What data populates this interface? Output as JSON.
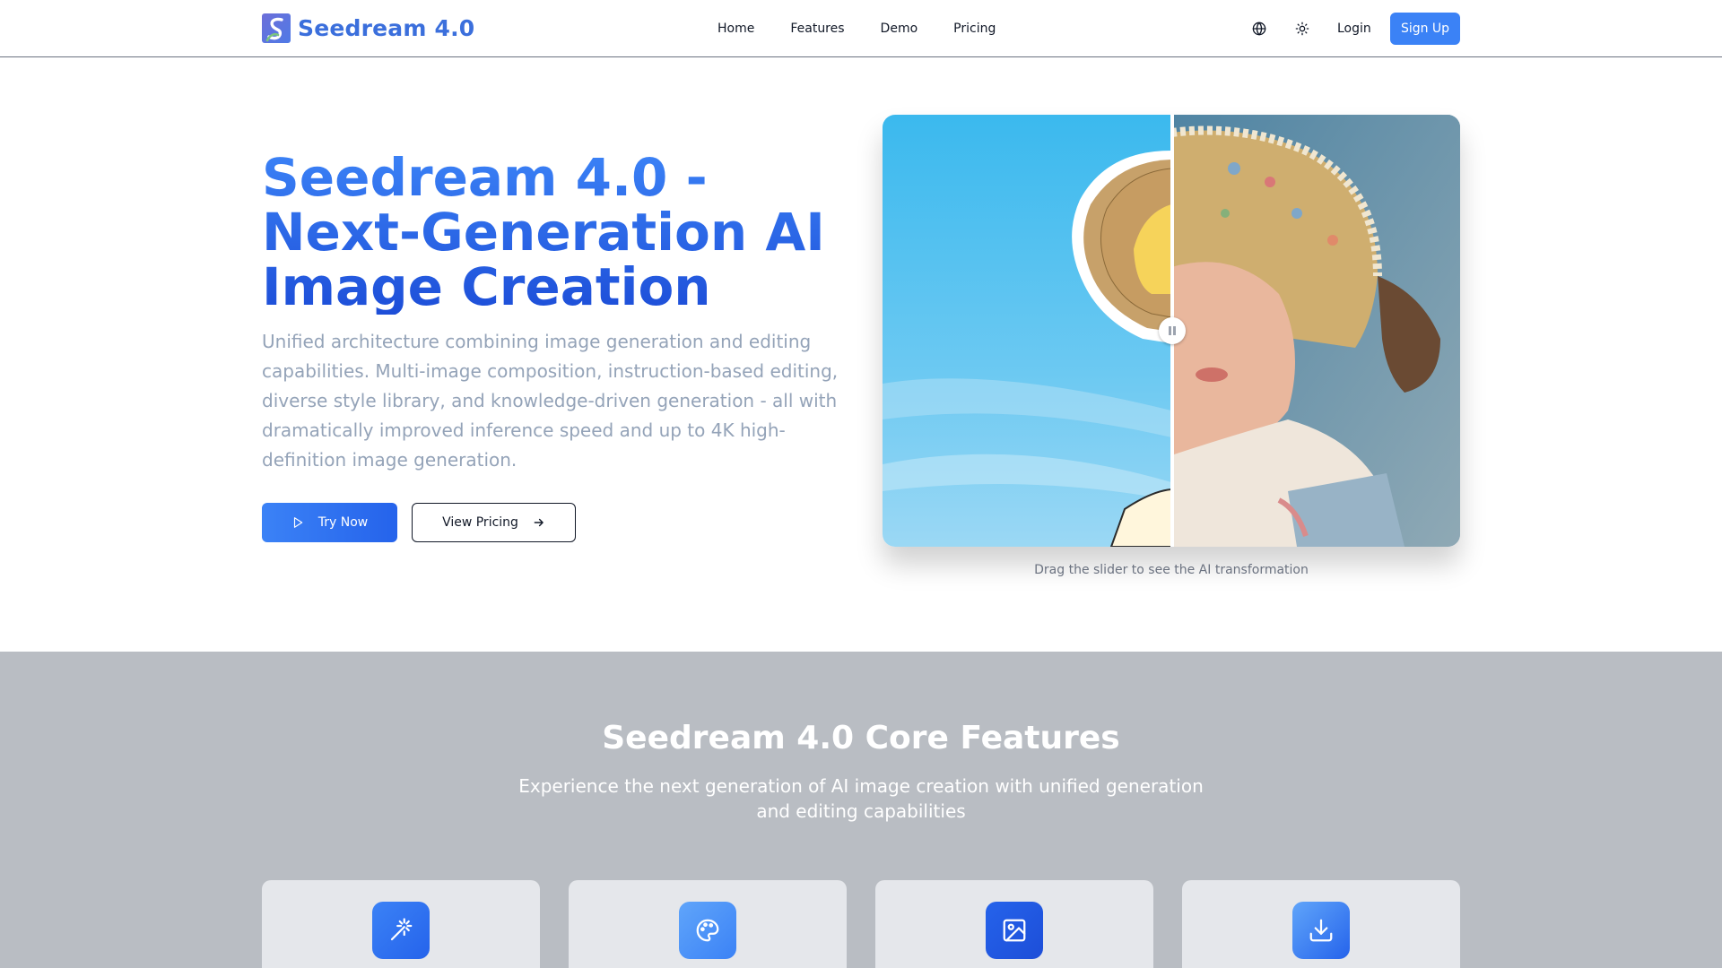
{
  "header": {
    "logo_text": "Seedream 4.0",
    "nav": [
      "Home",
      "Features",
      "Demo",
      "Pricing"
    ],
    "language_icon": "globe-icon",
    "theme_icon": "sun-icon",
    "login_label": "Login",
    "signup_label": "Sign Up"
  },
  "hero": {
    "title": "Seedream 4.0 - Next-Generation AI Image Creation",
    "description": "Unified architecture combining image generation and editing capabilities. Multi-image composition, instruction-based editing, diverse style library, and knowledge-driven generation - all with dramatically improved inference speed and up to 4K high-definition image generation.",
    "try_label": "Try Now",
    "pricing_label": "View Pricing",
    "compare_caption": "Drag the slider to see the AI transformation",
    "slider_position": 0.5
  },
  "features": {
    "title": "Seedream 4.0 Core Features",
    "subtitle": "Experience the next generation of AI image creation with unified generation and editing capabilities",
    "cards": [
      {
        "icon": "magic-wand-icon"
      },
      {
        "icon": "palette-icon"
      },
      {
        "icon": "image-icon"
      },
      {
        "icon": "download-icon"
      }
    ]
  },
  "colors": {
    "brand": "#3b82f6",
    "brand_dark": "#1d4ed8",
    "features_bg": "#b9bdc3"
  }
}
